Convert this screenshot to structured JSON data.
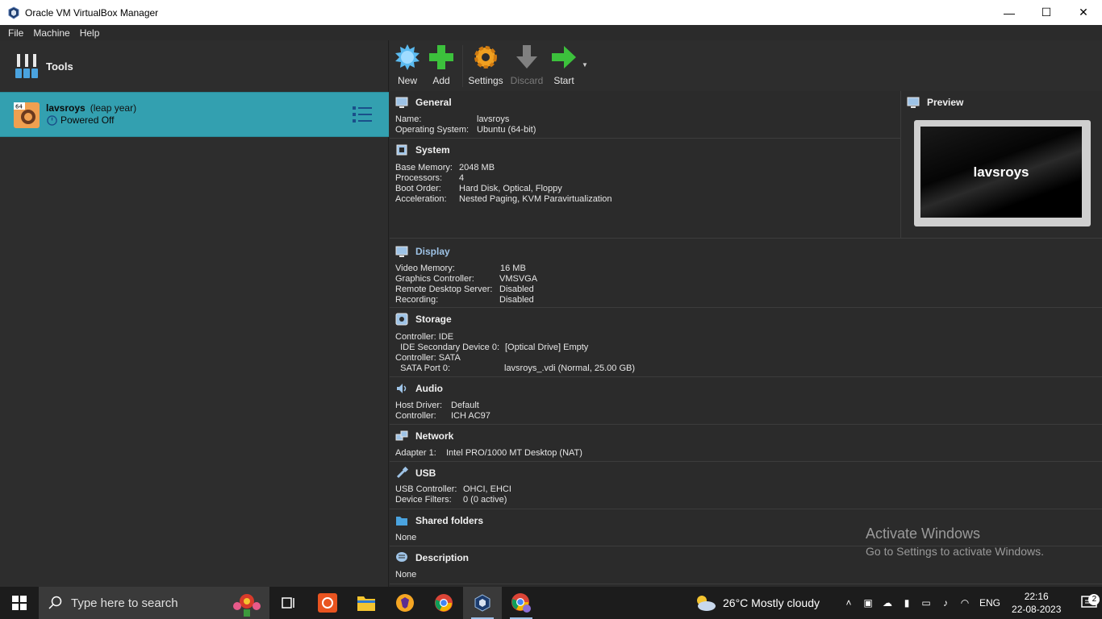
{
  "window": {
    "title": "Oracle VM VirtualBox Manager",
    "minimize_glyph": "—",
    "maximize_glyph": "☐",
    "close_glyph": "✕"
  },
  "menu": [
    "File",
    "Machine",
    "Help"
  ],
  "left": {
    "tools_label": "Tools",
    "vm": {
      "name": "lavsroys",
      "group": "(leap year)",
      "state": "Powered Off",
      "os_badge": "64"
    }
  },
  "toolbar": {
    "new": "New",
    "add": "Add",
    "settings": "Settings",
    "discard": "Discard",
    "start": "Start"
  },
  "details": {
    "general": {
      "title": "General",
      "rows": [
        [
          "Name:",
          "lavsroys"
        ],
        [
          "Operating System:",
          "Ubuntu (64-bit)"
        ]
      ]
    },
    "system": {
      "title": "System",
      "rows": [
        [
          "Base Memory:",
          "2048 MB"
        ],
        [
          "Processors:",
          "4"
        ],
        [
          "Boot Order:",
          "Hard Disk, Optical, Floppy"
        ],
        [
          "Acceleration:",
          "Nested Paging, KVM Paravirtualization"
        ]
      ]
    },
    "preview": {
      "title": "Preview",
      "screen_text": "lavsroys"
    },
    "display": {
      "title": "Display",
      "rows": [
        [
          "Video Memory:",
          "16 MB"
        ],
        [
          "Graphics Controller:",
          "VMSVGA"
        ],
        [
          "Remote Desktop Server:",
          "Disabled"
        ],
        [
          "Recording:",
          "Disabled"
        ]
      ]
    },
    "storage": {
      "title": "Storage",
      "rows": [
        [
          "Controller: IDE",
          ""
        ],
        [
          "  IDE Secondary Device 0:",
          "[Optical Drive] Empty"
        ],
        [
          "Controller: SATA",
          ""
        ],
        [
          "  SATA Port 0:",
          "lavsroys_.vdi (Normal, 25.00 GB)"
        ]
      ]
    },
    "audio": {
      "title": "Audio",
      "rows": [
        [
          "Host Driver:",
          "Default"
        ],
        [
          "Controller:",
          "ICH AC97"
        ]
      ]
    },
    "network": {
      "title": "Network",
      "rows": [
        [
          "Adapter 1:",
          "Intel PRO/1000 MT Desktop (NAT)"
        ]
      ]
    },
    "usb": {
      "title": "USB",
      "rows": [
        [
          "USB Controller:",
          "OHCI, EHCI"
        ],
        [
          "Device Filters:",
          "0 (0 active)"
        ]
      ]
    },
    "shared_folders": {
      "title": "Shared folders",
      "value": "None"
    },
    "description": {
      "title": "Description",
      "value": "None"
    }
  },
  "watermark": {
    "line1": "Activate Windows",
    "line2": "Go to Settings to activate Windows."
  },
  "taskbar": {
    "search_placeholder": "Type here to search",
    "weather": "26°C  Mostly cloudy",
    "language": "ENG",
    "time": "22:16",
    "date": "22-08-2023",
    "notification_count": "2",
    "apps": [
      "task-view-icon",
      "ubuntu-icon",
      "file-explorer-icon",
      "brave-icon",
      "chrome-icon",
      "virtualbox-icon",
      "chrome-profile-icon"
    ]
  },
  "colors": {
    "selection": "#33a0b0",
    "background": "#2b2b2b",
    "link": "#9ec3e6"
  }
}
